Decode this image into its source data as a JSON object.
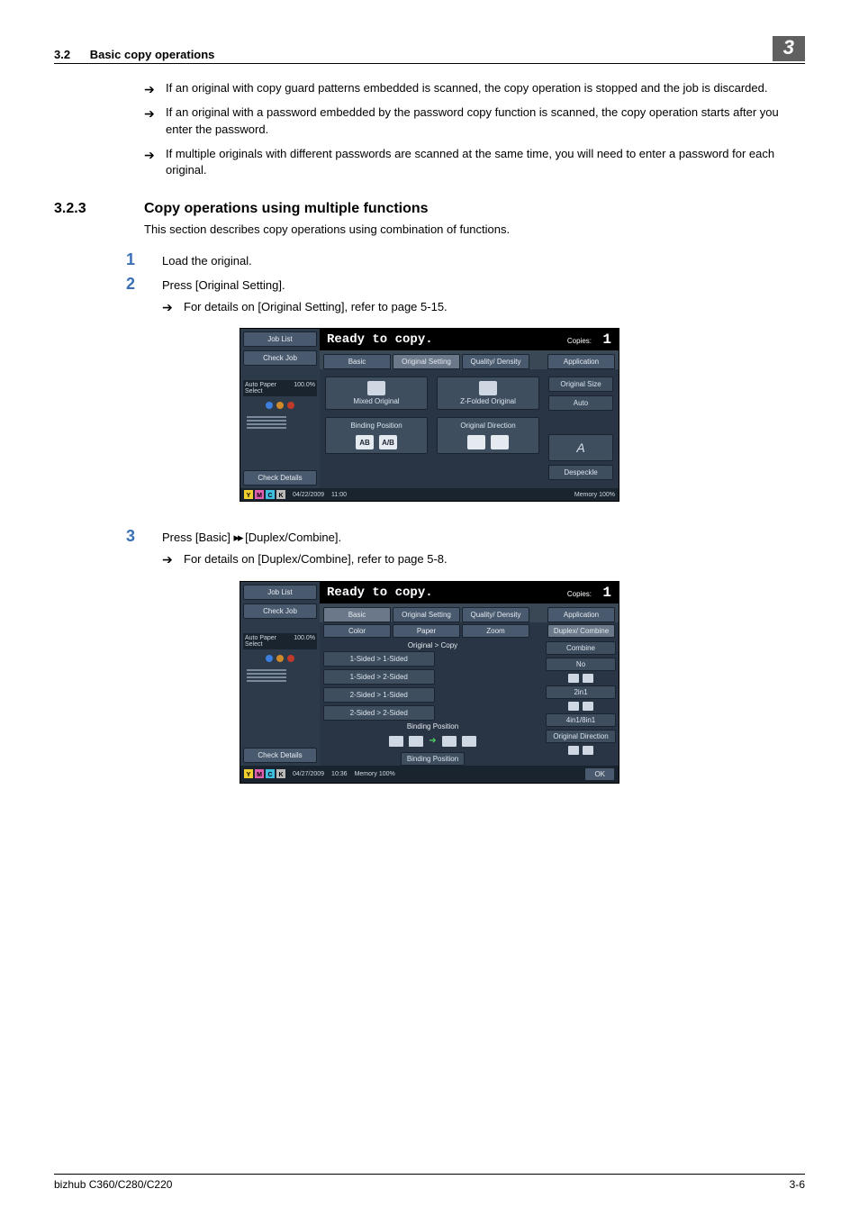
{
  "header": {
    "section_number": "3.2",
    "section_title": "Basic copy operations",
    "chapter_number": "3"
  },
  "bullets": [
    "If an original with copy guard patterns embedded is scanned, the copy operation is stopped and the job is discarded.",
    "If an original with a password embedded by the password copy function is scanned, the copy operation starts after you enter the password.",
    "If multiple originals with different passwords are scanned at the same time, you will need to enter a password for each original."
  ],
  "subsection": {
    "number": "3.2.3",
    "title": "Copy operations using multiple functions",
    "intro": "This section describes copy operations using combination of functions."
  },
  "steps": {
    "s1": {
      "num": "1",
      "text": "Load the original."
    },
    "s2": {
      "num": "2",
      "text": "Press [Original Setting].",
      "sub": "For details on [Original Setting], refer to page 5-15."
    },
    "s3": {
      "num": "3",
      "text_prefix": "Press [Basic] ",
      "text_suffix": " [Duplex/Combine].",
      "arrow_sep": "▸▸",
      "sub": "For details on [Duplex/Combine], refer to page 5-8."
    }
  },
  "screenshot1": {
    "sidebar": {
      "job_list": "Job List",
      "check_job": "Check Job",
      "auto_paper_label": "Auto Paper Select",
      "auto_paper_value": "100.0%",
      "check_details": "Check Details"
    },
    "status": {
      "text": "Ready to copy.",
      "copies_label": "Copies:",
      "copies_value": "1"
    },
    "tabs": {
      "basic": "Basic",
      "original_setting": "Original Setting",
      "quality_density": "Quality/ Density",
      "application": "Application"
    },
    "options": {
      "mixed": "Mixed Original",
      "zfolded": "Z-Folded Original",
      "binding_position": "Binding Position",
      "original_direction": "Original Direction",
      "original_size_label": "Original Size",
      "original_size_value": "Auto",
      "despeckle": "Despeckle",
      "bind_icon1": "AB",
      "bind_icon2": "A/B"
    },
    "footer": {
      "date": "04/22/2009",
      "time": "11:00",
      "memory_label": "Memory",
      "memory_value": "100%"
    }
  },
  "screenshot2": {
    "sidebar": {
      "job_list": "Job List",
      "check_job": "Check Job",
      "auto_paper_label": "Auto Paper Select",
      "auto_paper_value": "100.0%",
      "check_details": "Check Details"
    },
    "status": {
      "text": "Ready to copy.",
      "copies_label": "Copies:",
      "copies_value": "1"
    },
    "tabs": {
      "basic": "Basic",
      "original_setting": "Original Setting",
      "quality_density": "Quality/ Density",
      "application": "Application"
    },
    "subtabs": {
      "color": "Color",
      "paper": "Paper",
      "zoom": "Zoom",
      "duplex_combine": "Duplex/ Combine"
    },
    "breadcrumb": "Original > Copy",
    "sided": {
      "s1s1": "1-Sided > 1-Sided",
      "s1s2": "1-Sided > 2-Sided",
      "s2s1": "2-Sided > 1-Sided",
      "s2s2": "2-Sided > 2-Sided"
    },
    "binding_position_label": "Binding Position",
    "binding_position_button": "Binding Position",
    "right": {
      "combine": "Combine",
      "no": "No",
      "twoin1": "2in1",
      "fourin1_eightin1": "4in1/8in1",
      "original_direction": "Original Direction"
    },
    "ok": "OK",
    "footer": {
      "date": "04/27/2009",
      "time": "10:36",
      "memory_label": "Memory",
      "memory_value": "100%"
    }
  },
  "footer": {
    "model": "bizhub C360/C280/C220",
    "page": "3-6"
  }
}
